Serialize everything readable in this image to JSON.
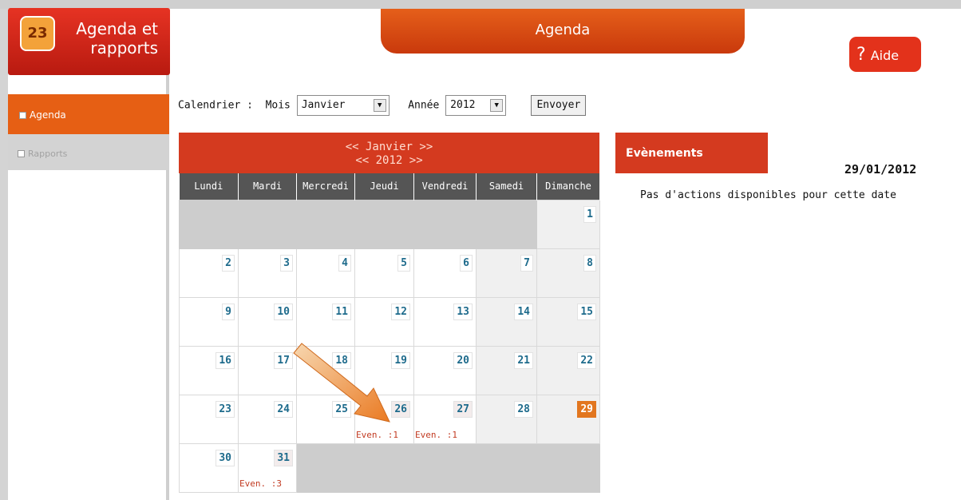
{
  "app": {
    "logo_icon": "23",
    "logo_text": "Agenda et rapports"
  },
  "sidebar": {
    "items": [
      {
        "label": "Agenda"
      },
      {
        "label": "Rapports"
      }
    ]
  },
  "header": {
    "title": "Agenda",
    "help_label": "Aide",
    "help_icon": "question-icon"
  },
  "form": {
    "calendar_label": "Calendrier :",
    "month_label": "Mois",
    "month_value": "Janvier",
    "year_label": "Année",
    "year_value": "2012",
    "submit_label": "Envoyer"
  },
  "calendar": {
    "month_nav": "<< Janvier >>",
    "year_nav": "<< 2012 >>",
    "weekdays": [
      "Lundi",
      "Mardi",
      "Mercredi",
      "Jeudi",
      "Vendredi",
      "Samedi",
      "Dimanche"
    ],
    "selected_day": "29",
    "weeks": [
      [
        "",
        "",
        "",
        "",
        "",
        "",
        "1"
      ],
      [
        "2",
        "3",
        "4",
        "5",
        "6",
        "7",
        "8"
      ],
      [
        "9",
        "10",
        "11",
        "12",
        "13",
        "14",
        "15"
      ],
      [
        "16",
        "17",
        "18",
        "19",
        "20",
        "21",
        "22"
      ],
      [
        "23",
        "24",
        "25",
        "26",
        "27",
        "28",
        "29"
      ],
      [
        "30",
        "31",
        "",
        "",
        "",
        "",
        ""
      ]
    ],
    "events": {
      "26": "Even. :1",
      "27": "Even. :1",
      "31": "Even. :3"
    }
  },
  "events_panel": {
    "title": "Evènements",
    "date": "29/01/2012",
    "message": "Pas d'actions disponibles pour cette date"
  }
}
